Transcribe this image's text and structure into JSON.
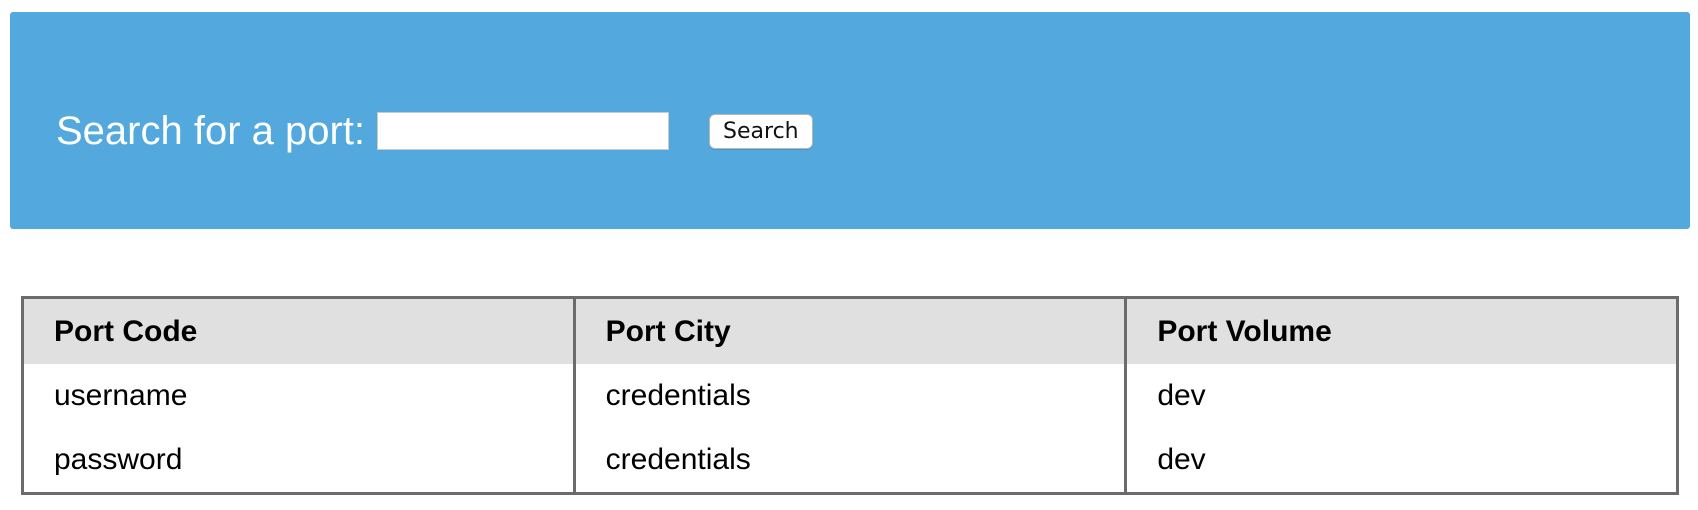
{
  "search": {
    "label": "Search for a port:",
    "input_value": "",
    "placeholder": "",
    "button_label": "Search"
  },
  "colors": {
    "banner": "#53a9de",
    "header_row": "#e0e0e0",
    "border": "#6b6b6b"
  },
  "table": {
    "headers": [
      "Port Code",
      "Port City",
      "Port Volume"
    ],
    "rows": [
      [
        "username",
        "credentials",
        "dev"
      ],
      [
        "password",
        "credentials",
        "dev"
      ]
    ]
  }
}
